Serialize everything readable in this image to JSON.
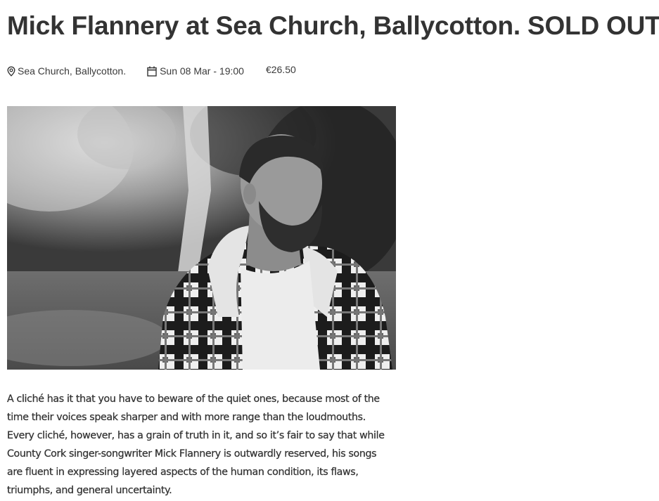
{
  "event": {
    "title": "Mick Flannery at Sea Church, Ballycotton. SOLD OUT",
    "location_icon": "map-marker-icon",
    "location": "Sea Church, Ballycotton.",
    "date_icon": "calendar-icon",
    "date": "Sun 08 Mar - 19:00",
    "price": "€26.50",
    "image_alt": "Black and white photo of Mick Flannery in a plaid jacket outdoors",
    "description": "A cliché has it that you have to beware of the quiet ones, because most of the time their voices speak sharper and with more range than the loudmouths. Every cliché, however, has a grain of truth in it, and so it’s fair to say that while County Cork singer-songwriter Mick Flannery is outwardly reserved, his songs are fluent in expressing layered aspects of the human condition, its flaws, triumphs, and general uncertainty."
  }
}
